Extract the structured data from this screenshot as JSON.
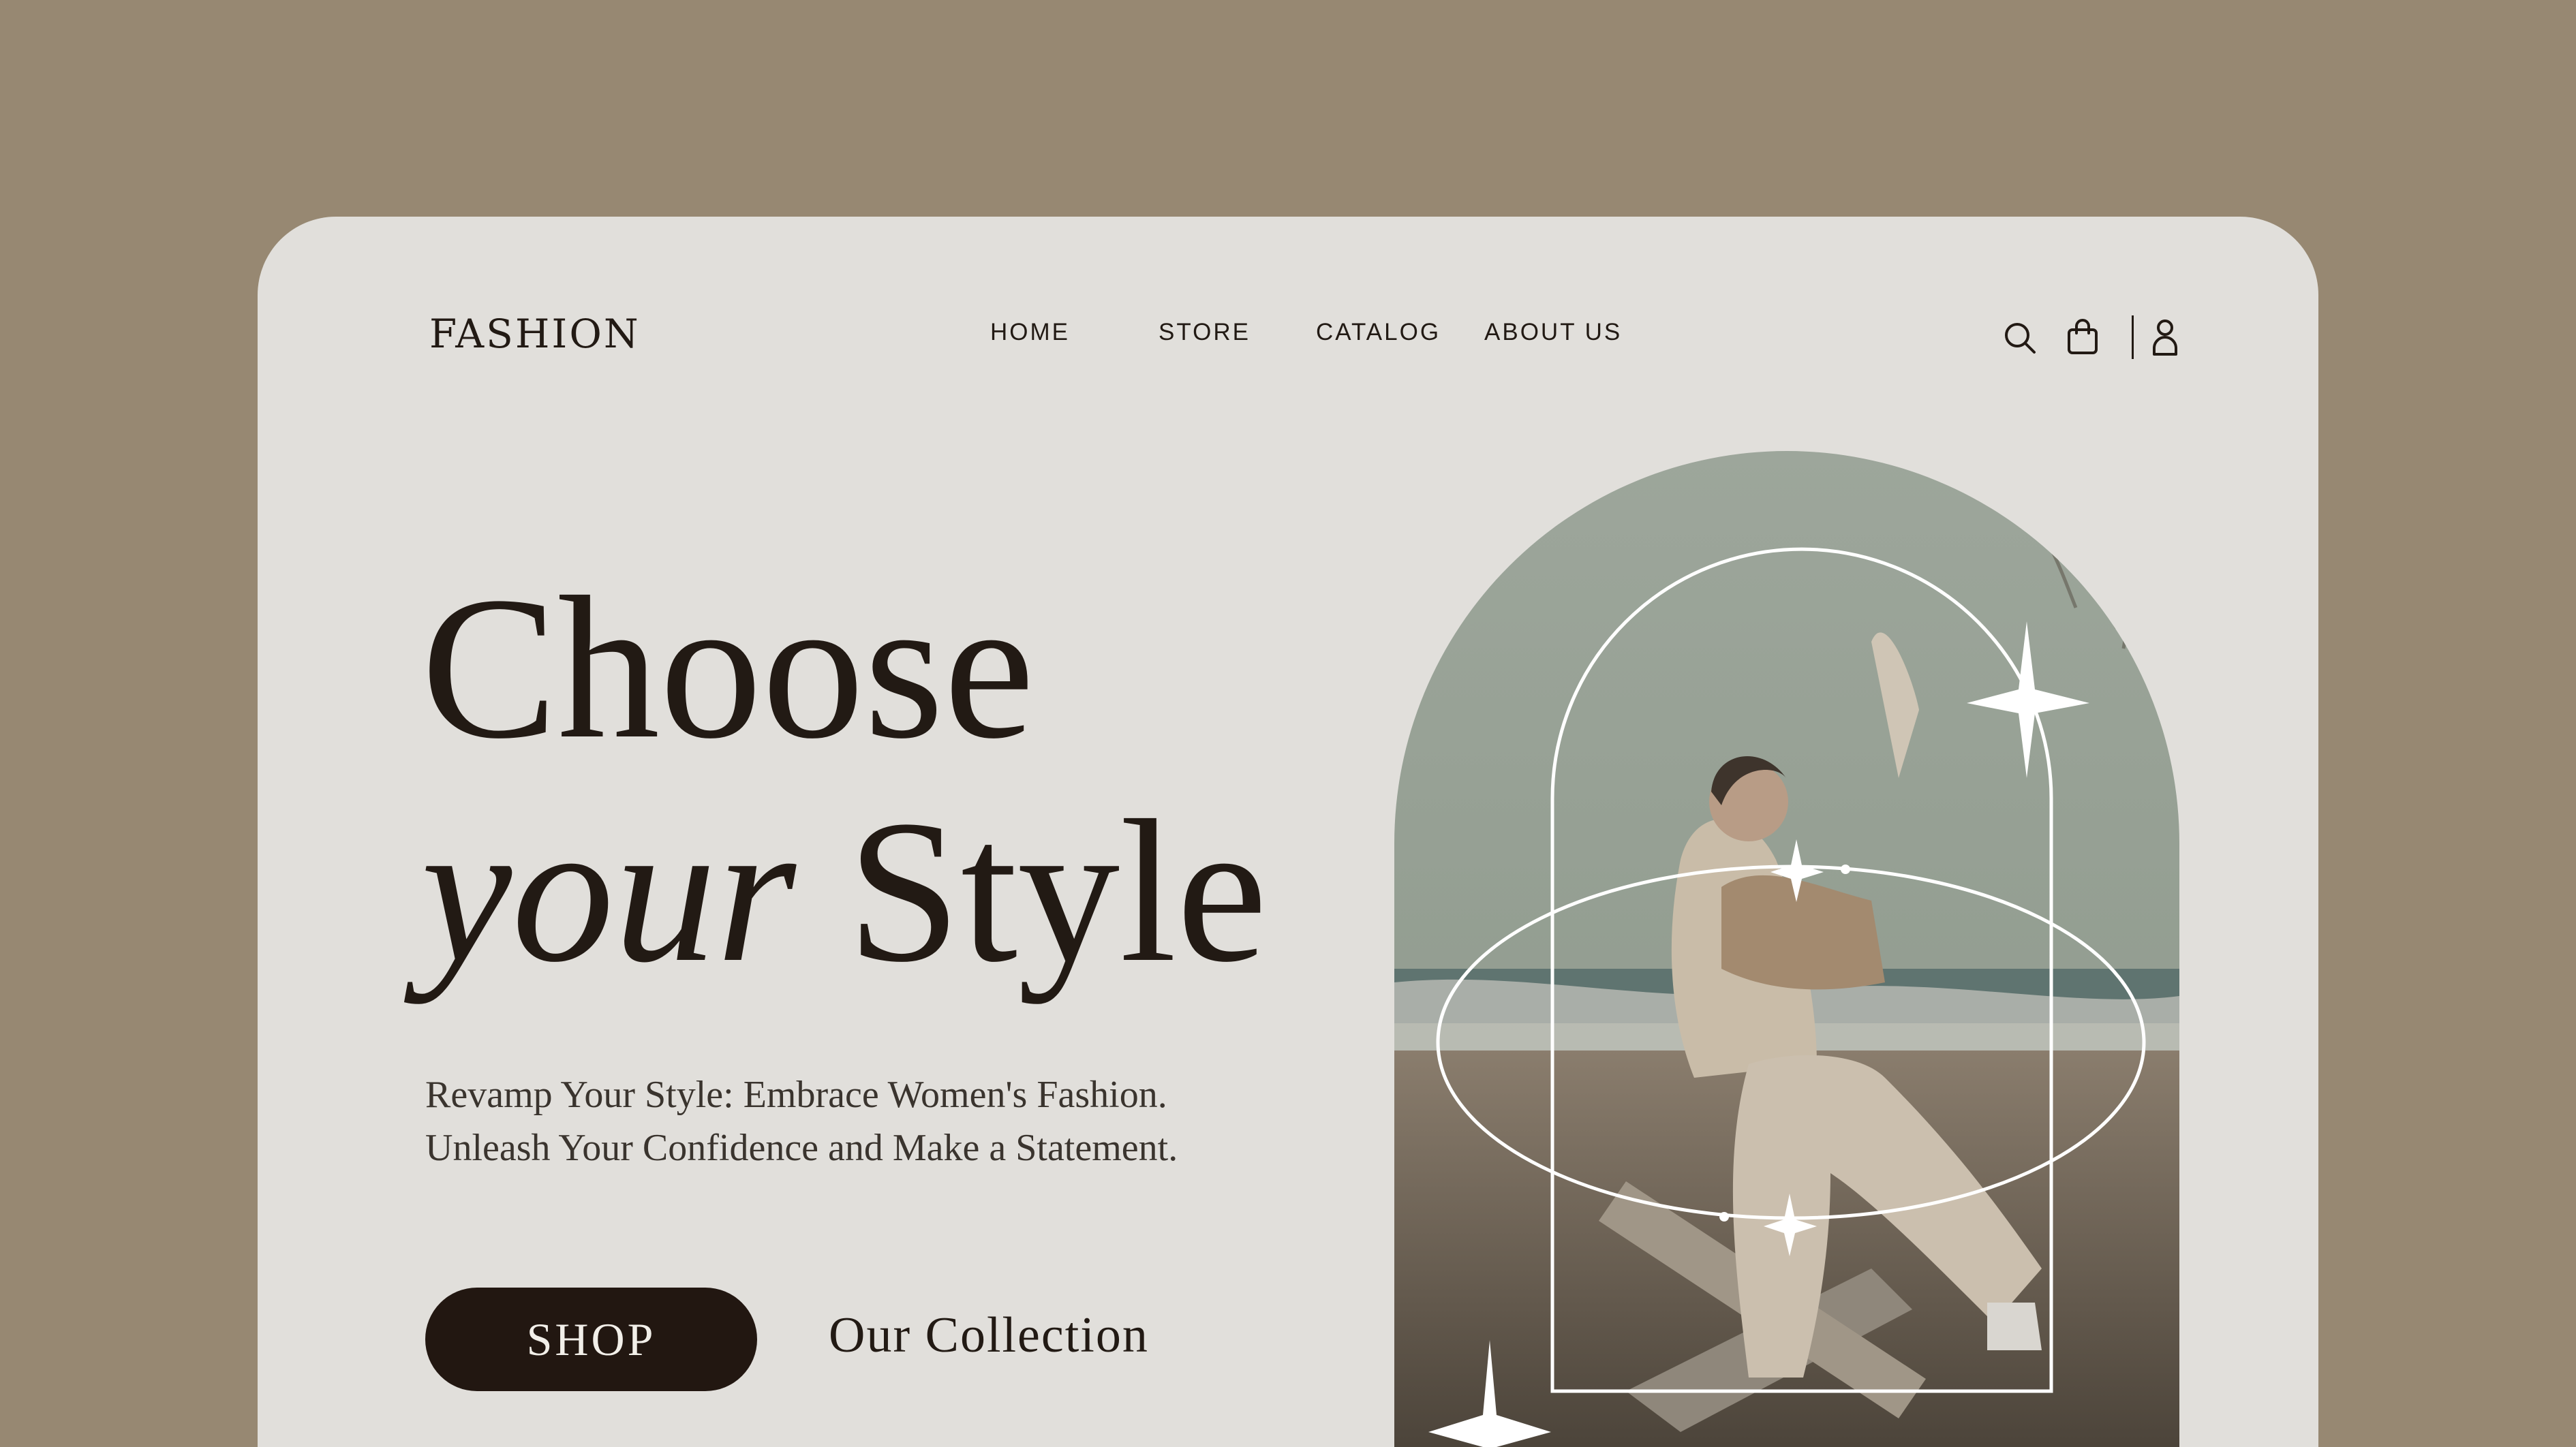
{
  "brand": {
    "logo": "FASHION"
  },
  "nav": {
    "items": [
      {
        "label": "HOME"
      },
      {
        "label": "STORE"
      },
      {
        "label": "CATALOG"
      },
      {
        "label": "ABOUT US"
      }
    ]
  },
  "header_icons": [
    "search-icon",
    "shopping-bag-icon",
    "user-icon"
  ],
  "hero": {
    "headline_line1": "Choose",
    "headline_line2_italic": "your",
    "headline_line2_rest": "Style",
    "subtitle_line1": "Revamp Your Style: Embrace Women's Fashion.",
    "subtitle_line2": "Unleash Your Confidence and Make a Statement.",
    "shop_button": "SHOP",
    "collection_link": "Our Collection"
  },
  "colors": {
    "page_background": "#978872",
    "card_background": "#e1dfdb",
    "text_dark": "#221a14",
    "button_background": "#221711",
    "button_text": "#f2efe9"
  }
}
